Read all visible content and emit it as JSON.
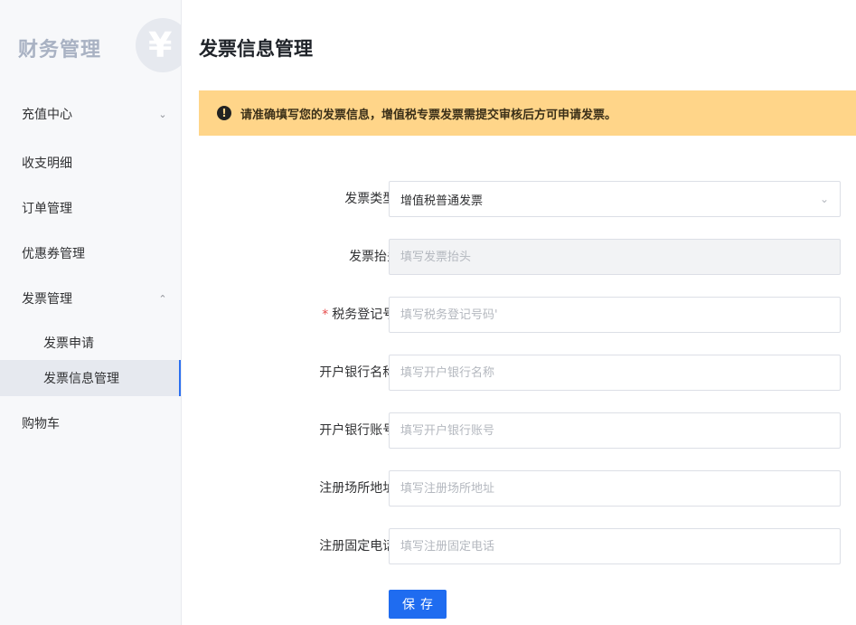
{
  "sidebar": {
    "brand": "财务管理",
    "brand_symbol": "¥",
    "items": [
      {
        "label": "充值中心",
        "chevron": "chevron-down-icon"
      },
      {
        "label": "收支明细"
      },
      {
        "label": "订单管理"
      },
      {
        "label": "优惠券管理"
      },
      {
        "label": "发票管理",
        "chevron": "chevron-up-icon"
      },
      {
        "label": "发票申请"
      },
      {
        "label": "发票信息管理",
        "active": true
      },
      {
        "label": "购物车"
      }
    ]
  },
  "main": {
    "title": "发票信息管理",
    "alert": {
      "icon": "exclamation-circle-icon",
      "text": "请准确填写您的发票信息，增值税专票发票需提交审核后方可申请发票。"
    },
    "form": {
      "invoice_type": {
        "label": "发票类型:",
        "value": "增值税普通发票"
      },
      "invoice_title": {
        "label": "发票抬头",
        "placeholder": "填写发票抬头"
      },
      "tax_number": {
        "label": "税务登记号:",
        "placeholder": "填写税务登记号码'",
        "required_mark": "*"
      },
      "bank_name": {
        "label": "开户银行名称:",
        "placeholder": "填写开户银行名称"
      },
      "bank_account": {
        "label": "开户银行账号:",
        "placeholder": "填写开户银行账号"
      },
      "reg_address": {
        "label": "注册场所地址:",
        "placeholder": "填写注册场所地址"
      },
      "reg_phone": {
        "label": "注册固定电话:",
        "placeholder": "填写注册固定电话"
      },
      "save_label": "保存"
    }
  },
  "colors": {
    "accent": "#1f6cf0",
    "alert_bg": "#ffd589",
    "required": "#e64b4b"
  }
}
